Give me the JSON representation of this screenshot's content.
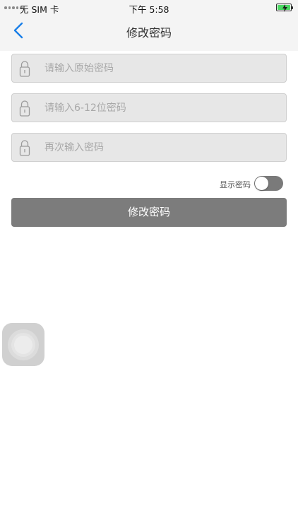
{
  "status_bar": {
    "carrier": "无 SIM 卡",
    "time": "下午 5:58",
    "battery_color": "#4cd964"
  },
  "nav": {
    "title": "修改密码",
    "back_icon": "chevron-left-icon",
    "accent_color": "#1a7fe8"
  },
  "form": {
    "fields": [
      {
        "placeholder": "请输入原始密码",
        "value": "",
        "icon": "lock-icon"
      },
      {
        "placeholder": "请输入6-12位密码",
        "value": "",
        "icon": "lock-icon"
      },
      {
        "placeholder": "再次输入密码",
        "value": "",
        "icon": "lock-icon"
      }
    ],
    "show_password_label": "显示密码",
    "show_password_on": false,
    "submit_label": "修改密码"
  },
  "assistive_touch": {
    "icon": "assistive-touch-icon"
  }
}
